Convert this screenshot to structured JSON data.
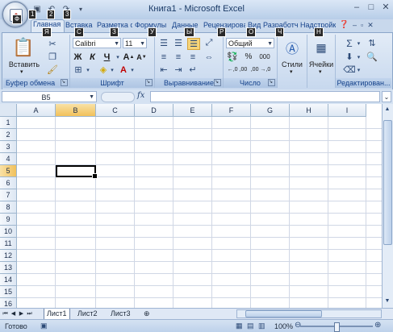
{
  "window": {
    "title": "Книга1 - Microsoft Excel",
    "office_button_keytip": "Ф",
    "quick_access": [
      {
        "icon": "save-icon",
        "keytip": "1"
      },
      {
        "icon": "undo-icon",
        "keytip": "2"
      },
      {
        "icon": "redo-icon",
        "keytip": "3"
      }
    ],
    "controls": {
      "minimize": "–",
      "maximize": "□",
      "close": "✕"
    }
  },
  "ribbon": {
    "tabs": [
      {
        "label": "Главная",
        "keytip": "Я",
        "active": true
      },
      {
        "label": "Вставка",
        "keytip": "С"
      },
      {
        "label": "Разметка страницы",
        "keytip": "З"
      },
      {
        "label": "Формулы",
        "keytip": "У"
      },
      {
        "label": "Данные",
        "keytip": "Ы"
      },
      {
        "label": "Рецензирование",
        "keytip": "Р"
      },
      {
        "label": "Вид",
        "keytip": "О"
      },
      {
        "label": "Разработчик",
        "keytip": "Ч"
      },
      {
        "label": "Надстройки",
        "keytip": "Н"
      }
    ],
    "help_icon": "help-icon",
    "groups": {
      "clipboard": {
        "label": "Буфер обмена",
        "paste_label": "Вставить"
      },
      "font": {
        "label": "Шрифт",
        "font_name": "Calibri",
        "font_size": "11",
        "bold": "Ж",
        "italic": "К",
        "underline": "Ч"
      },
      "alignment": {
        "label": "Выравнивание"
      },
      "number": {
        "label": "Число",
        "format": "Общий",
        "percent": "%",
        "thousands": "000",
        "inc_decimal": "←,0 ,00",
        "dec_decimal": ",00 →,0"
      },
      "styles": {
        "label": "Стили"
      },
      "cells": {
        "label": "Ячейки"
      },
      "editing": {
        "label": "Редактирован..."
      }
    }
  },
  "formula_bar": {
    "name_box": "B5",
    "fx": "fx",
    "formula": ""
  },
  "grid": {
    "columns": [
      "A",
      "B",
      "C",
      "D",
      "E",
      "F",
      "G",
      "H",
      "I"
    ],
    "rows": [
      "1",
      "2",
      "3",
      "4",
      "5",
      "6",
      "7",
      "8",
      "9",
      "10",
      "11",
      "12",
      "13",
      "14",
      "15",
      "16"
    ],
    "selected_column": "B",
    "selected_row": "5",
    "active_cell": "B5"
  },
  "sheets": {
    "tabs": [
      "Лист1",
      "Лист2",
      "Лист3"
    ],
    "active": "Лист1"
  },
  "status_bar": {
    "status": "Готово",
    "zoom": "100%"
  }
}
